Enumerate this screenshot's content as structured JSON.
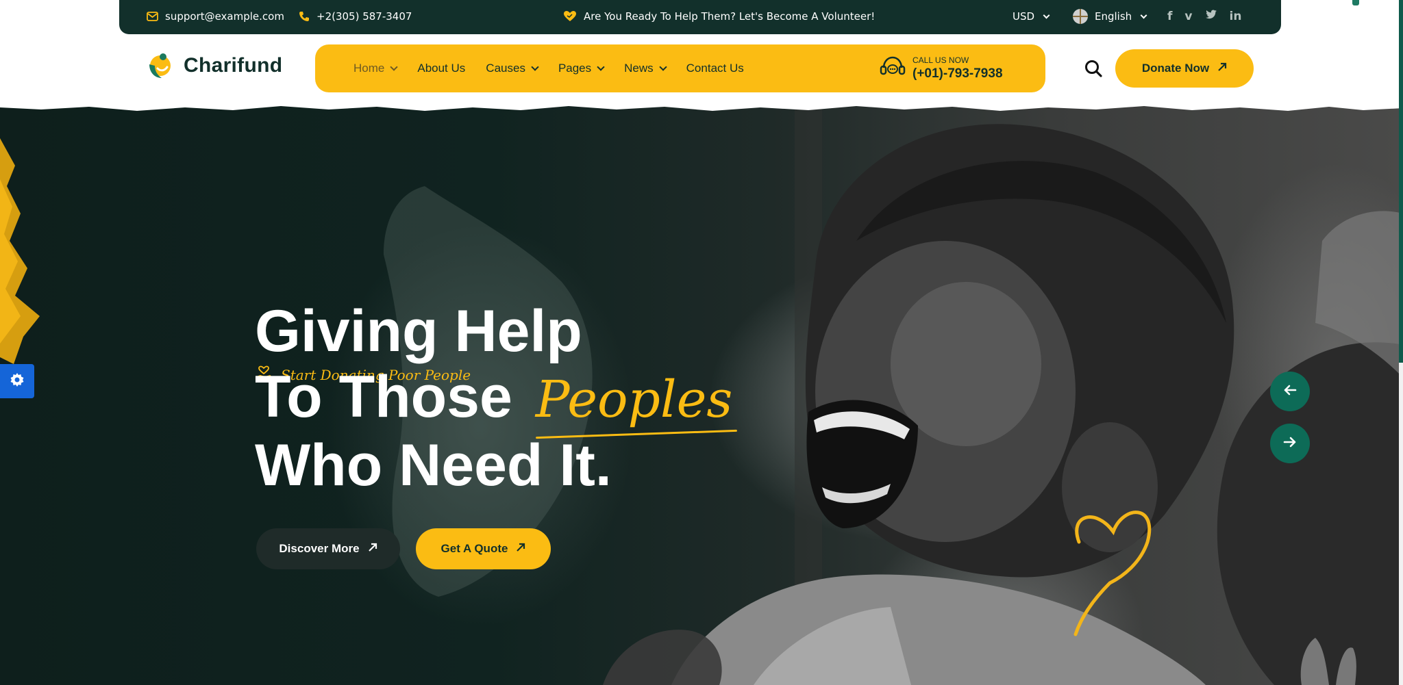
{
  "topbar": {
    "email": "support@example.com",
    "phone": "+2(305) 587-3407",
    "announcement": "Are You Ready To Help Them? Let's Become A Volunteer!",
    "currency": "USD",
    "language": "English",
    "social": [
      {
        "name": "facebook-icon",
        "glyph": "f"
      },
      {
        "name": "vimeo-icon",
        "glyph": "v"
      },
      {
        "name": "twitter-icon",
        "glyph": "t"
      },
      {
        "name": "linkedin-icon",
        "glyph": "in"
      }
    ]
  },
  "header": {
    "logo_text": "Charifund",
    "nav": [
      {
        "label": "Home",
        "dropdown": true,
        "active": true
      },
      {
        "label": "About Us",
        "dropdown": false
      },
      {
        "label": "Causes",
        "dropdown": true
      },
      {
        "label": "Pages",
        "dropdown": true
      },
      {
        "label": "News",
        "dropdown": true
      },
      {
        "label": "Contact Us",
        "dropdown": false
      }
    ],
    "call_label": "CALL US NOW",
    "call_number": "(+01)-793-7938",
    "donate_label": "Donate Now"
  },
  "hero": {
    "subtitle": "Start Donating Poor People",
    "headline_line1": "Giving Help",
    "headline_line2": "To Those",
    "headline_accent": "Peoples",
    "headline_line3": "Who Need It.",
    "discover_label": "Discover More",
    "quote_label": "Get A Quote"
  },
  "colors": {
    "brand_dark": "#12302b",
    "accent_yellow": "#fbbc13",
    "slider_green": "#0d6b57",
    "settings_blue": "#1565d8"
  }
}
